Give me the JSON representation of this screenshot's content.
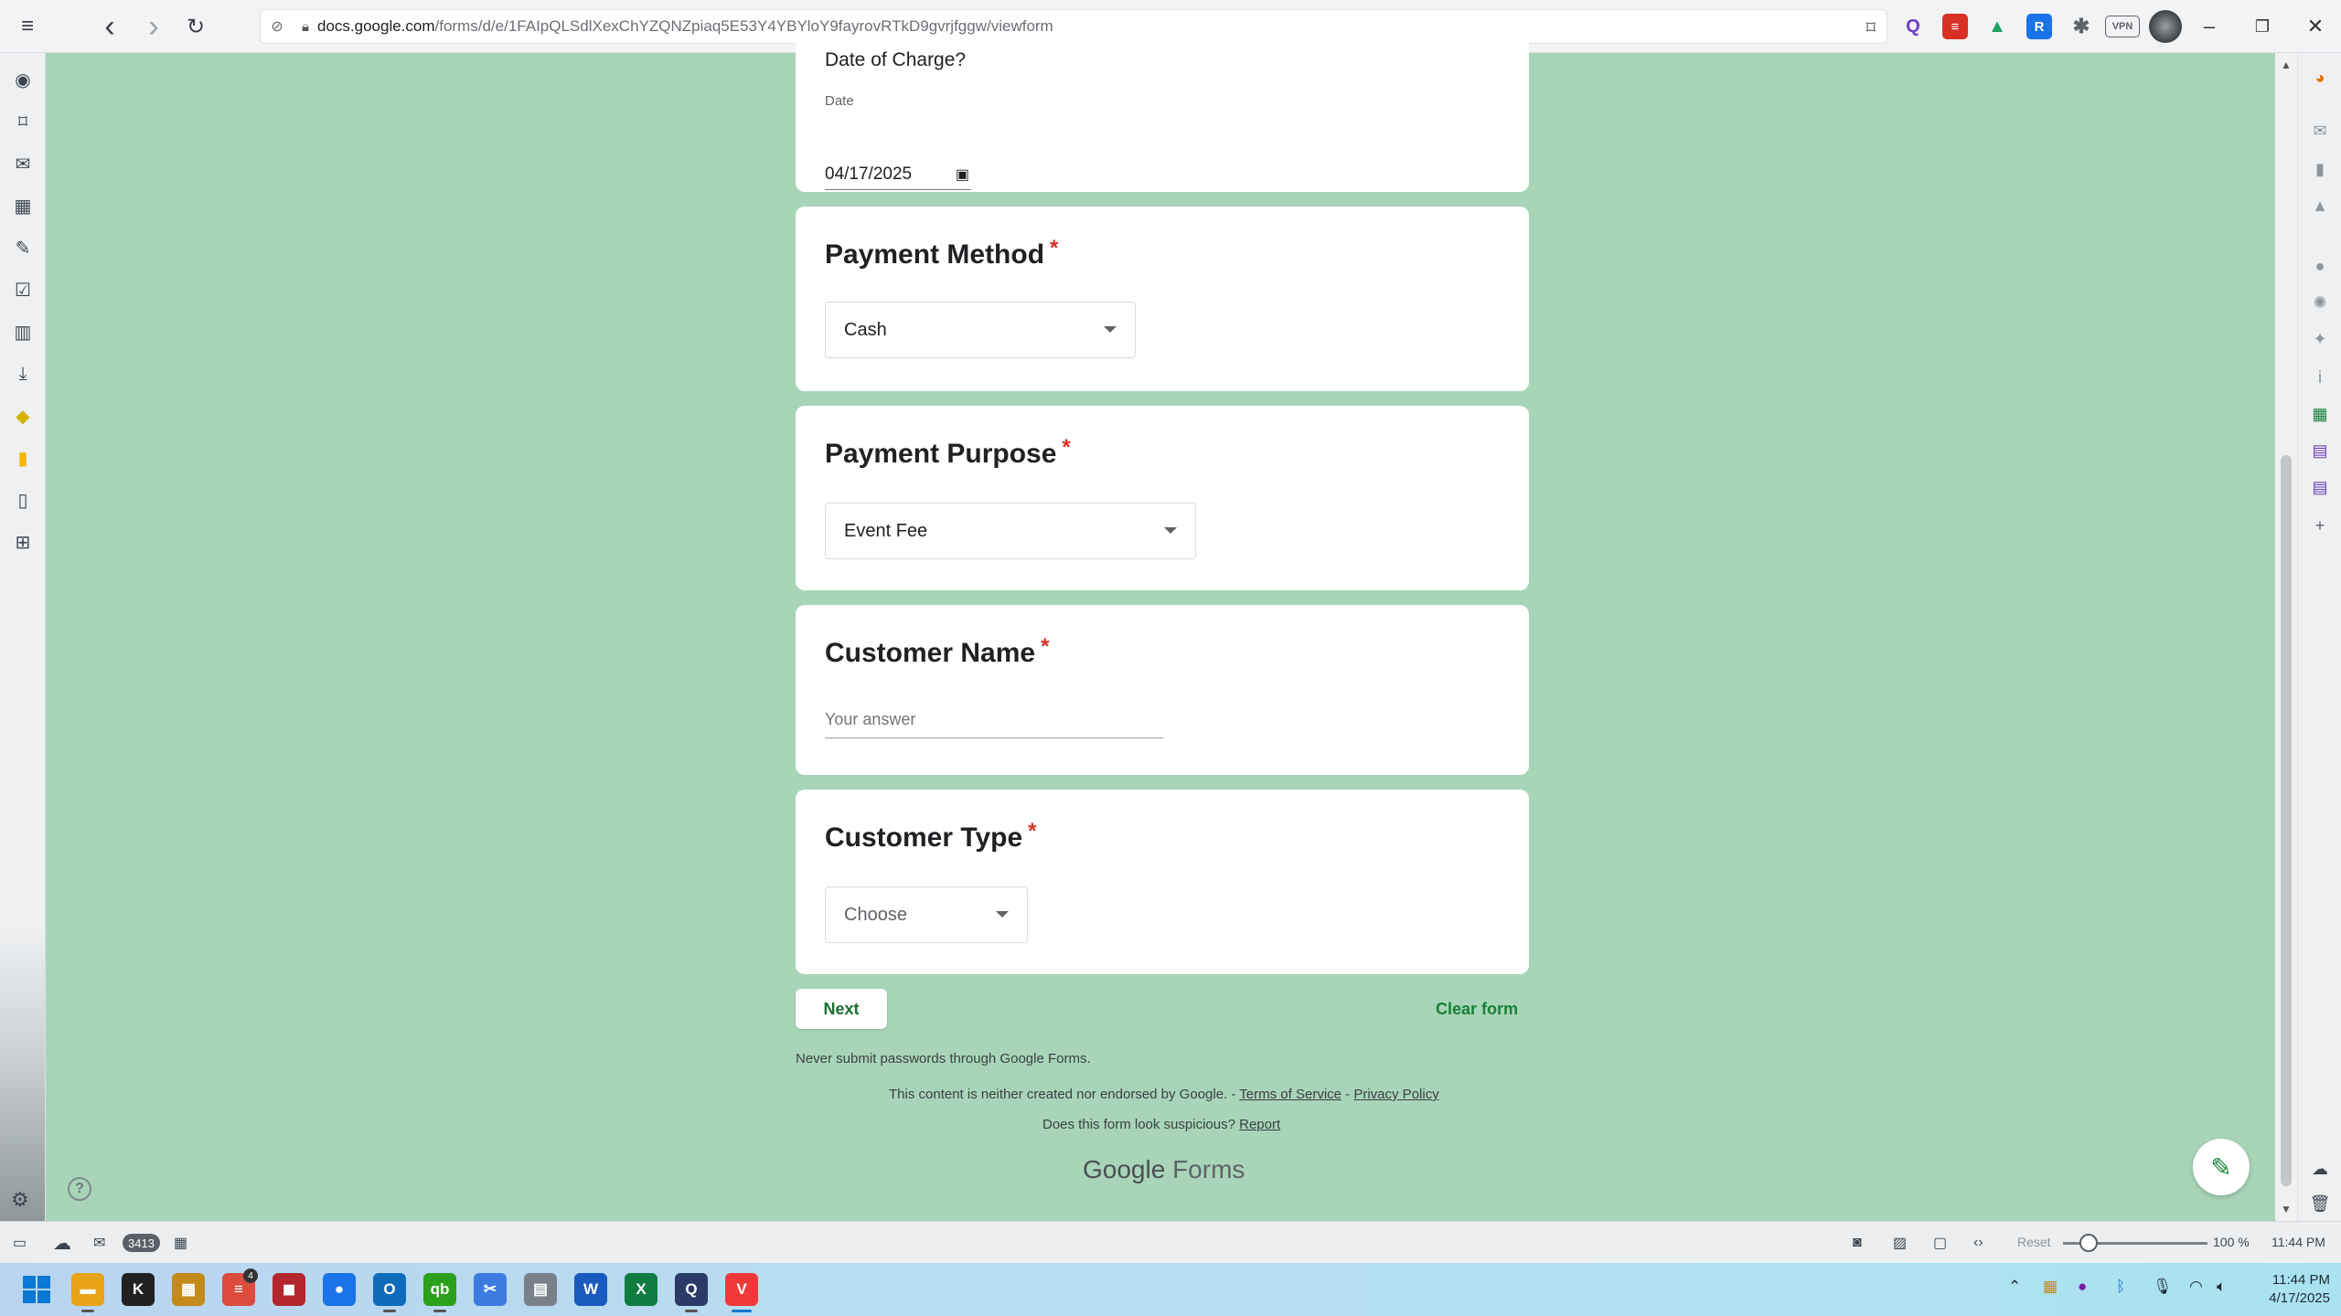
{
  "browser": {
    "url_domain": "docs.google.com",
    "url_path": "/forms/d/e/1FAIpQLSdlXexChYZQNZpiaq5E53Y4YBYloY9fayrovRTkD9gvrjfggw/viewform",
    "nav": {
      "menu": "≡",
      "back": "‹",
      "forward": "›",
      "reload": "↻"
    },
    "extensions": [
      {
        "name": "search-ext-icon",
        "label": "Q",
        "color": "#6b3fc4"
      },
      {
        "name": "pdf-ext-icon",
        "label": "≡",
        "color": "#d93025"
      },
      {
        "name": "drive-ext-icon",
        "label": "▲",
        "color": "#1ea362"
      },
      {
        "name": "bookmark-ext-icon",
        "label": "R",
        "color": "#1a73e8"
      },
      {
        "name": "puzzle-ext-icon",
        "label": "✱",
        "color": "#5f6368"
      },
      {
        "name": "vpn-ext-icon",
        "label": "VPN",
        "color": "#5f6368"
      }
    ]
  },
  "form": {
    "date_question": {
      "title": "Date of Charge?",
      "sub_label": "Date",
      "value": "04/17/2025"
    },
    "payment_method": {
      "title": "Payment Method",
      "required_mark": "*",
      "selected": "Cash"
    },
    "payment_purpose": {
      "title": "Payment Purpose",
      "required_mark": "*",
      "selected": "Event Fee"
    },
    "customer_name": {
      "title": "Customer Name",
      "required_mark": "*",
      "placeholder": "Your answer"
    },
    "customer_type": {
      "title": "Customer Type",
      "required_mark": "*",
      "selected": "Choose"
    },
    "next_label": "Next",
    "clear_label": "Clear form",
    "footer": {
      "warning": "Never submit passwords through Google Forms.",
      "disclaimer": "This content is neither created nor endorsed by Google. -",
      "terms": "Terms of Service",
      "sep": "-",
      "privacy": "Privacy Policy",
      "suspicious": "Does this form look suspicious?",
      "report": "Report"
    },
    "brand_google": "Google",
    "brand_forms": "Forms"
  },
  "statusbar": {
    "mail_count": "3413",
    "reset": "Reset",
    "zoom": "100 %",
    "zoom_level_percent": 100,
    "time": "11:44 PM"
  },
  "taskbar": {
    "badge": "4",
    "clock_time": "11:44 PM",
    "clock_date": "4/17/2025",
    "apps": [
      {
        "name": "file-explorer-icon",
        "label": "▬",
        "color": "#e8a317"
      },
      {
        "name": "k-app-icon",
        "label": "K",
        "color": "#222222"
      },
      {
        "name": "gallery-app-icon",
        "label": "▦",
        "color": "#c48a1b"
      },
      {
        "name": "todoist-app-icon",
        "label": "≡",
        "color": "#db4c3f"
      },
      {
        "name": "red-app-icon",
        "label": "◼",
        "color": "#b3262e"
      },
      {
        "name": "chrome-app-icon",
        "label": "●",
        "color": "#1a73e8"
      },
      {
        "name": "outlook-app-icon",
        "label": "O",
        "color": "#0f6cbd"
      },
      {
        "name": "quickbooks-app-icon",
        "label": "qb",
        "color": "#2ca01c"
      },
      {
        "name": "snipping-tool-icon",
        "label": "✂",
        "color": "#3d7be0"
      },
      {
        "name": "printer-app-icon",
        "label": "▤",
        "color": "#7a8088"
      },
      {
        "name": "word-app-icon",
        "label": "W",
        "color": "#185abd"
      },
      {
        "name": "excel-app-icon",
        "label": "X",
        "color": "#107c41"
      },
      {
        "name": "search-app-icon",
        "label": "Q",
        "color": "#2b3a67"
      },
      {
        "name": "vivaldi-app-icon",
        "label": "V",
        "color": "#ef3939"
      }
    ]
  }
}
